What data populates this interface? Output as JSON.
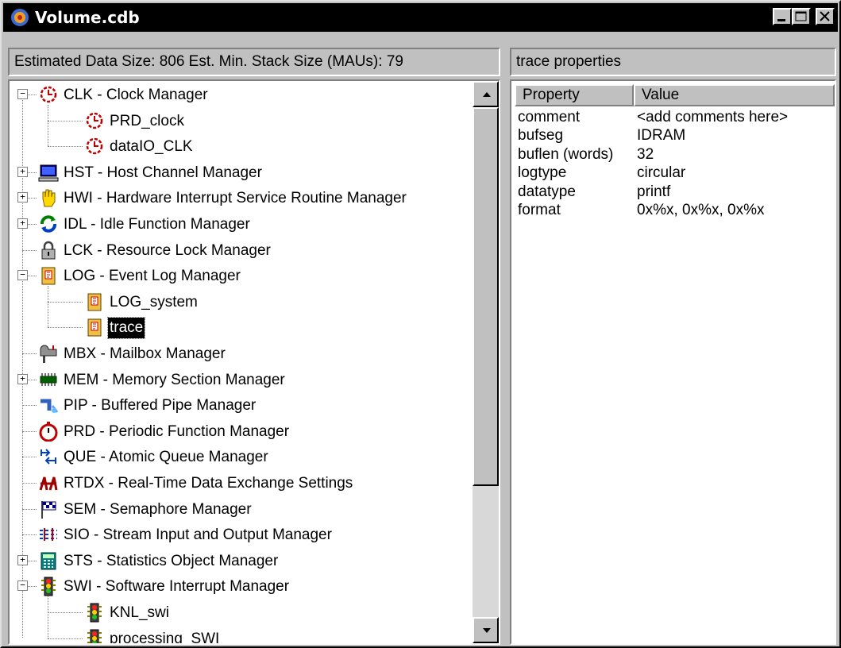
{
  "window": {
    "title": "Volume.cdb"
  },
  "left_header": {
    "text": "Estimated Data Size: 806   Est. Min. Stack Size (MAUs): 79"
  },
  "tree": [
    {
      "label": "CLK - Clock Manager",
      "icon": "clock-icon",
      "expander": "−"
    },
    {
      "label": "PRD_clock",
      "icon": "clock-icon"
    },
    {
      "label": "dataIO_CLK",
      "icon": "clock-icon"
    },
    {
      "label": "HST - Host Channel Manager",
      "icon": "computer-icon",
      "expander": "+"
    },
    {
      "label": "HWI - Hardware Interrupt Service Routine Manager",
      "icon": "hand-icon",
      "expander": "+"
    },
    {
      "label": "IDL - Idle Function Manager",
      "icon": "cycle-arrows-icon",
      "expander": "+"
    },
    {
      "label": "LCK - Resource Lock Manager",
      "icon": "padlock-icon"
    },
    {
      "label": "LOG - Event Log Manager",
      "icon": "log-book-icon",
      "expander": "−"
    },
    {
      "label": "LOG_system",
      "icon": "log-book-icon"
    },
    {
      "label": "trace",
      "icon": "log-book-icon",
      "selected": true
    },
    {
      "label": "MBX - Mailbox Manager",
      "icon": "mailbox-icon"
    },
    {
      "label": "MEM - Memory Section Manager",
      "icon": "memory-chip-icon",
      "expander": "+"
    },
    {
      "label": "PIP - Buffered Pipe Manager",
      "icon": "pipe-icon"
    },
    {
      "label": "PRD - Periodic Function Manager",
      "icon": "stopwatch-icon"
    },
    {
      "label": "QUE - Atomic Queue Manager",
      "icon": "queue-arrows-icon"
    },
    {
      "label": "RTDX - Real-Time Data Exchange Settings",
      "icon": "rtdx-icon"
    },
    {
      "label": "SEM - Semaphore Manager",
      "icon": "flag-icon"
    },
    {
      "label": "SIO - Stream Input and Output Manager",
      "icon": "stream-icon"
    },
    {
      "label": "STS - Statistics Object Manager",
      "icon": "calculator-icon",
      "expander": "+"
    },
    {
      "label": "SWI - Software Interrupt Manager",
      "icon": "traffic-light-icon",
      "expander": "−"
    },
    {
      "label": "KNL_swi",
      "icon": "traffic-light-icon"
    },
    {
      "label": "processing_SWI",
      "icon": "traffic-light-icon"
    }
  ],
  "right_header": {
    "text": "trace properties"
  },
  "props": {
    "col_property": "Property",
    "col_value": "Value",
    "rows": [
      {
        "name": "comment",
        "value": "<add comments here>"
      },
      {
        "name": "bufseg",
        "value": "IDRAM"
      },
      {
        "name": "buflen (words)",
        "value": "32"
      },
      {
        "name": "logtype",
        "value": "circular"
      },
      {
        "name": "datatype",
        "value": "printf"
      },
      {
        "name": "format",
        "value": "0x%x, 0x%x, 0x%x"
      }
    ]
  }
}
